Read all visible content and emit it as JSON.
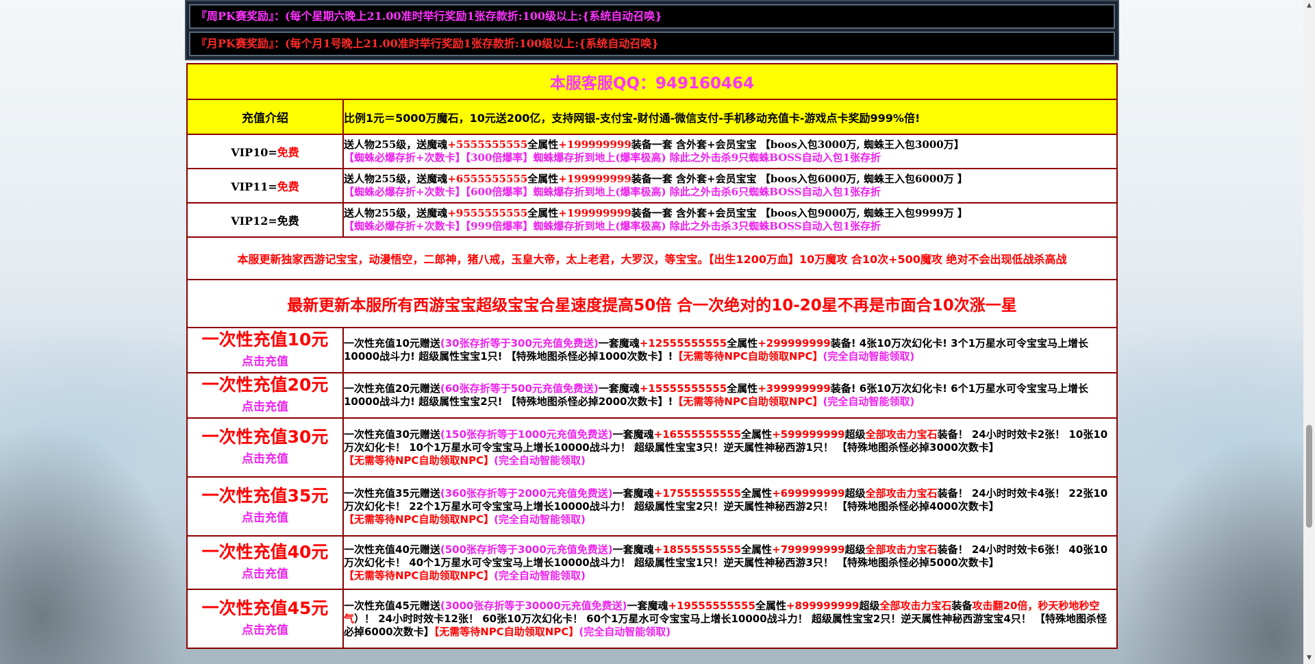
{
  "notices": [
    "『周PK赛奖励』：(每个星期六晚上21.00准时举行奖励1张存款折:100级以上:{系统自动召唤}",
    "『月PK赛奖励』：(每个月1号晚上21.00准时举行奖励1张存款折:100级以上:{系统自动召唤}"
  ],
  "qq": {
    "title": "本服客服QQ：949160464"
  },
  "intro": {
    "label": "充值介绍",
    "text": "比例1元＝5000万魔石，10元送200亿，支持网银-支付宝-财付通-微信支付-手机移动充值卡-游戏点卡奖励999%倍!"
  },
  "vips": [
    {
      "label_prefix": "VIP10=",
      "label_free": "免费",
      "l1_a": "送人物255级，送魔魂",
      "l1_b": "+5555555555",
      "l1_c": "全属性",
      "l1_d": "+199999999",
      "l1_e": "装备一套 含外套+会员宝宝 【boos入包3000万, 蜘蛛王入包3000万】",
      "l2": "【蜘蛛必爆存折+次数卡】【300倍爆率】蜘蛛爆存折到地上(爆率极高) 除此之外击杀9只蜘蛛BOSS自动入包1张存折"
    },
    {
      "label_prefix": "VIP11=",
      "label_free": "免费",
      "l1_a": "送人物255级，送魔魂",
      "l1_b": "+6555555555",
      "l1_c": "全属性",
      "l1_d": "+199999999",
      "l1_e": "装备一套 含外套+会员宝宝 【boos入包6000万, 蜘蛛王入包6000万 】",
      "l2": "【蜘蛛必爆存折+次数卡】【600倍爆率】蜘蛛爆存折到地上(爆率极高) 除此之外击杀6只蜘蛛BOSS自动入包1张存折"
    },
    {
      "label_prefix": "VIP12=",
      "label_free": "免费",
      "l1_a": "送人物255级，送魔魂",
      "l1_b": "+9555555555",
      "l1_c": "全属性",
      "l1_d": "+199999999",
      "l1_e": "装备一套 含外套+会员宝宝 【boos入包9000万, 蜘蛛王入包9999万 】",
      "l2": "【蜘蛛必爆存折+次数卡】【999倍爆率】蜘蛛爆存折到地上(爆率极高) 除此之外击杀3只蜘蛛BOSS自动入包1张存折"
    }
  ],
  "announce1": "本服更新独家西游记宝宝，动漫悟空，二郎神，猪八戒，玉皇大帝，太上老君，大罗汉，等宝宝。【出生1200万血】10万魔攻 合10次+500魔攻 绝对不会出现低战杀高战",
  "announce2": "最新更新本服所有西游宝宝超级宝宝合星速度提高50倍 合一次绝对的10-20星不再是市面合10次涨一星",
  "charge_link": "点击充值",
  "charges": [
    {
      "title": "一次性充值10元",
      "t1": "一次性充值10元赠送",
      "t2": "(30张存折等于300元充值免费送)",
      "t3": "一套魔魂",
      "t4": "+12555555555",
      "t5": "全属性",
      "t6": "+299999999",
      "t7": "装备! 4张10万次幻化卡! 3个1万星水可令宝宝马上增长10000战斗力! 超级属性宝宝1只! 【特殊地图杀怪必掉1000次数卡】!",
      "t8": "【无需等待NPC自助领取NPC】",
      "t9": "(完全自动智能领取)"
    },
    {
      "title": "一次性充值20元",
      "t1": "一次性充值20元赠送",
      "t2": "(60张存折等于500元充值免费送)",
      "t3": "一套魔魂",
      "t4": "+15555555555",
      "t5": "全属性",
      "t6": "+399999999",
      "t7": "装备! 6张10万次幻化卡! 6个1万星水可令宝宝马上增长10000战斗力! 超级属性宝宝2只! 【特殊地图杀怪必掉2000次数卡】!",
      "t8": "【无需等待NPC自助领取NPC】",
      "t9": "(完全自动智能领取)"
    },
    {
      "title": "一次性充值30元",
      "t1": "一次性充值30元赠送",
      "t2": "(150张存折等于1000元充值免费送)",
      "t3": "一套魔魂",
      "t4": "+16555555555",
      "t5": "全属性",
      "t6": "+599999999",
      "t7a": "超级",
      "t7b": "全部攻击力宝石",
      "t7": "装备！ 24小时时效卡2张！ 10张10万次幻化卡！ 10个1万星水可令宝宝马上增长10000战斗力！ 超级属性宝宝3只！逆天属性神秘西游1只！ 【特殊地图杀怪必掉3000次数卡】",
      "t8": "【无需等待NPC自助领取NPC】",
      "t9": "(完全自动智能领取)"
    },
    {
      "title": "一次性充值35元",
      "t1": "一次性充值35元赠送",
      "t2": "(360张存折等于2000元充值免费送)",
      "t3": "一套魔魂",
      "t4": "+17555555555",
      "t5": "全属性",
      "t6": "+699999999",
      "t7a": "超级",
      "t7b": "全部攻击力宝石",
      "t7": "装备！ 24小时时效卡4张！ 22张10万次幻化卡！ 22个1万星水可令宝宝马上增长10000战斗力！ 超级属性宝宝2只！逆天属性神秘西游2只！ 【特殊地图杀怪必掉4000次数卡】",
      "t8": "【无需等待NPC自助领取NPC】",
      "t9": "(完全自动智能领取)"
    },
    {
      "title": "一次性充值40元",
      "t1": "一次性充值40元赠送",
      "t2": "(500张存折等于3000元充值免费送)",
      "t3": "一套魔魂",
      "t4": "+18555555555",
      "t5": "全属性",
      "t6": "+799999999",
      "t7a": "超级",
      "t7b": "全部攻击力宝石",
      "t7": "装备！ 24小时时效卡6张！ 40张10万次幻化卡！ 40个1万星水可令宝宝马上增长10000战斗力！ 超级属性宝宝1只！逆天属性神秘西游3只！ 【特殊地图杀怪必掉5000次数卡】",
      "t8": "【无需等待NPC自助领取NPC】",
      "t9": "(完全自动智能领取)"
    },
    {
      "title": "一次性充值45元",
      "t1": "一次性充值45元赠送",
      "t2": "(3000张存折等于30000元充值免费送)",
      "t3": "一套魔魂",
      "t4": "+19555555555",
      "t5": "全属性",
      "t6": "+899999999",
      "t7a": "超级",
      "t7b": "全部攻击力宝石",
      "t7c": "装备",
      "t7d": "攻击翻20倍，秒天秒地秒空气",
      "t7": "）！ 24小时时效卡12张！ 60张10万次幻化卡！ 60个1万星水可令宝宝马上增长10000战斗力！ 超级属性宝宝2只！逆天属性神秘西游宝宝4只！ 【特殊地图杀怪必掉6000次数卡】",
      "t8": "【无需等待NPC自助领取NPC】",
      "t9": "(完全自动智能领取)"
    }
  ]
}
